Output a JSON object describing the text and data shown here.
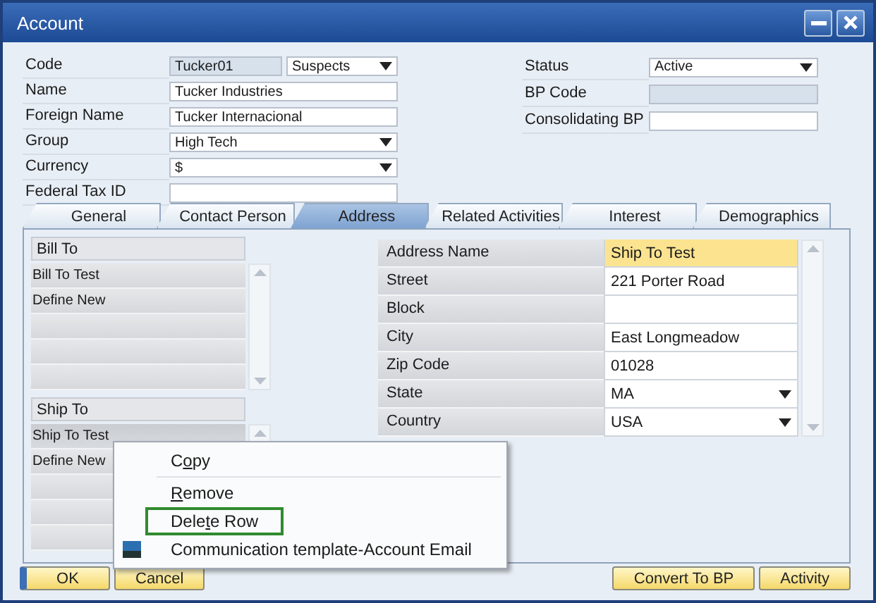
{
  "window": {
    "title": "Account"
  },
  "header_left": [
    {
      "label": "Code",
      "kind": "code",
      "value": "Tucker01",
      "series": "Suspects"
    },
    {
      "label": "Name",
      "kind": "text",
      "value": "Tucker Industries"
    },
    {
      "label": "Foreign Name",
      "kind": "text",
      "value": "Tucker Internacional"
    },
    {
      "label": "Group",
      "kind": "dropdown",
      "value": "High Tech"
    },
    {
      "label": "Currency",
      "kind": "dropdown",
      "value": "$"
    },
    {
      "label": "Federal Tax ID",
      "kind": "text"
    }
  ],
  "header_right": [
    {
      "label": "Status",
      "kind": "dropdown",
      "value": "Active"
    },
    {
      "label": "BP Code",
      "kind": "readonly"
    },
    {
      "label": "Consolidating BP",
      "kind": "text"
    }
  ],
  "tabs": [
    {
      "label": "General",
      "selected": false
    },
    {
      "label": "Contact Person",
      "selected": false
    },
    {
      "label": "Address",
      "selected": true
    },
    {
      "label": "Related Activities",
      "selected": false
    },
    {
      "label": "Interest",
      "selected": false
    },
    {
      "label": "Demographics",
      "selected": false
    }
  ],
  "address_lists": [
    {
      "header": "Bill To",
      "rows": [
        {
          "label": "Bill To Test",
          "selected": false
        },
        {
          "label": "Define New",
          "selected": false
        }
      ]
    },
    {
      "header": "Ship To",
      "rows": [
        {
          "label": "Ship To Test",
          "selected": true
        },
        {
          "label": "Define New",
          "selected": false
        }
      ]
    }
  ],
  "address_fields": [
    {
      "label": "Address Name",
      "kind": "text",
      "value": "Ship To Test",
      "focused": true
    },
    {
      "label": "Street",
      "kind": "text",
      "value": "221 Porter Road",
      "focused": false
    },
    {
      "label": "Block",
      "kind": "text",
      "focused": false
    },
    {
      "label": "City",
      "kind": "text",
      "value": "East Longmeadow",
      "focused": false
    },
    {
      "label": "Zip Code",
      "kind": "text",
      "value": "01028",
      "focused": false
    },
    {
      "label": "State",
      "kind": "dropdown",
      "value": "MA",
      "focused": false
    },
    {
      "label": "Country",
      "kind": "dropdown",
      "value": "USA",
      "focused": false
    }
  ],
  "context_menu": [
    {
      "kind": "plain",
      "parts": [
        {
          "text": "C",
          "underline": false
        },
        {
          "text": "o",
          "underline": true
        },
        {
          "text": "py",
          "underline": false
        }
      ],
      "selected": false
    },
    {
      "kind": "plain",
      "parts": [
        {
          "text": "R",
          "underline": true
        },
        {
          "text": "emove",
          "underline": false
        }
      ],
      "selected": false
    },
    {
      "kind": "plain",
      "parts": [
        {
          "text": "Dele",
          "underline": false
        },
        {
          "text": "t",
          "underline": true
        },
        {
          "text": "e Row",
          "underline": false
        }
      ],
      "selected": true
    },
    {
      "kind": "with_icon",
      "parts": [
        {
          "text": "Communication template-Account Email",
          "underline": false
        }
      ],
      "selected": false
    }
  ],
  "buttons_left": [
    {
      "label": "OK",
      "default": true
    },
    {
      "label": "Cancel",
      "default": false
    }
  ],
  "buttons_right": [
    {
      "label": "Convert To BP",
      "default": false
    },
    {
      "label": "Activity",
      "default": false
    }
  ]
}
